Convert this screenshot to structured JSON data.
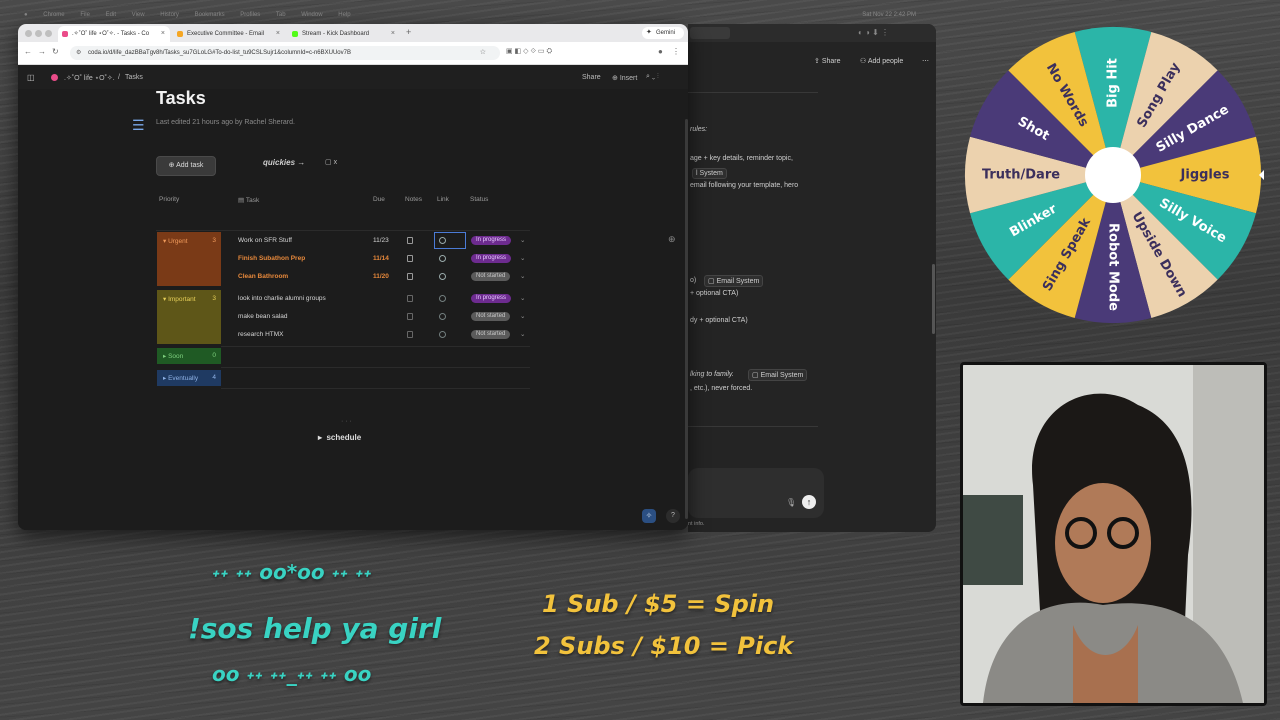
{
  "menubar": {
    "items": [
      "Chrome",
      "File",
      "Edit",
      "View",
      "History",
      "Bookmarks",
      "Profiles",
      "Tab",
      "Window",
      "Help"
    ],
    "clock": "Sat Nov 22  2:42 PM"
  },
  "browser": {
    "tabs": [
      {
        "label": ".✧˚O˚ life ⋆O˚✧. - Tasks - Co",
        "color": "#ea4c89"
      },
      {
        "label": "Executive Committee - Email",
        "color": "#f5a623"
      },
      {
        "label": "Stream - Kick Dashboard",
        "color": "#53fc18"
      }
    ],
    "url": "coda.io/d/life_dazBBaTgv8h/Tasks_su7GLoLG#To-do-list_tu9CSLSujr1&columnId=c-n6BXUUov7B",
    "gemini_label": "Gemini"
  },
  "coda": {
    "breadcrumb_doc": ".✧˚O˚ life ⋆O˚✧.",
    "breadcrumb_sep": "/",
    "breadcrumb_page": "Tasks",
    "share_label": "Share",
    "insert_label": "Insert",
    "title": "Tasks",
    "subtitle": "Last edited 21 hours ago by Rachel Sherard.",
    "add_task_label": "Add task",
    "quickies_label": "quickies →",
    "checkbox_x": "x",
    "columns": {
      "priority": "Priority",
      "task": "Task",
      "due": "Due",
      "notes": "Notes",
      "link": "Link",
      "status": "Status"
    },
    "groups": [
      {
        "name": "Urgent",
        "count": "3",
        "color": "#7a3a17",
        "text": "#f09a5b"
      },
      {
        "name": "Important",
        "count": "3",
        "color": "#5e5618",
        "text": "#e6cf58"
      },
      {
        "name": "Soon",
        "count": "0",
        "color": "#1f5a24",
        "text": "#7ed07e"
      },
      {
        "name": "Eventually",
        "count": "4",
        "color": "#1f3a62",
        "text": "#8fb2e6"
      }
    ],
    "rows": [
      {
        "task": "Work on SFR Stuff",
        "due": "11/23",
        "status": "In progress"
      },
      {
        "task": "Finish Subathon Prep",
        "due": "11/14",
        "status": "In progress"
      },
      {
        "task": "Clean Bathroom",
        "due": "11/20",
        "status": "Not started"
      },
      {
        "task": "look into charlie alumni groups",
        "due": "",
        "status": "In progress"
      },
      {
        "task": "make bean salad",
        "due": "",
        "status": "Not started"
      },
      {
        "task": "research HTMX",
        "due": "",
        "status": "Not started"
      }
    ],
    "schedule_label": "schedule",
    "dots": "· · ·",
    "help_label": "?"
  },
  "chat": {
    "share_label": "Share",
    "add_people_label": "Add people",
    "lines": [
      "rules:",
      "age + key details, reminder topic,",
      "email following your template, hero",
      "o)",
      "+ optional CTA)",
      "dy + optional CTA)",
      "lking to family.",
      ", etc.), never forced.",
      "nt info."
    ],
    "tag_label": "Email System",
    "tag_short": "l System"
  },
  "wheel": {
    "segments": [
      {
        "label": "Big Hit",
        "color": "#2bb5a8"
      },
      {
        "label": "Song Play",
        "color": "#ecd2ae"
      },
      {
        "label": "Silly Dance",
        "color": "#4a3a78"
      },
      {
        "label": "Jiggles",
        "color": "#f2c23c"
      },
      {
        "label": "Silly Voice",
        "color": "#2bb5a8"
      },
      {
        "label": "Upside Down",
        "color": "#ecd2ae"
      },
      {
        "label": "Robot Mode",
        "color": "#4a3a78"
      },
      {
        "label": "Sing Speak",
        "color": "#f2c23c"
      },
      {
        "label": "Blinker",
        "color": "#2bb5a8"
      },
      {
        "label": "Truth/Dare",
        "color": "#ecd2ae"
      },
      {
        "label": "Shot",
        "color": "#4a3a78"
      },
      {
        "label": "No Words",
        "color": "#f2c23c"
      }
    ]
  },
  "overlay": {
    "deco_top": "˖˖ ˖˖ oo*oo ˖˖ ˖˖",
    "handle": "!sos help ya girl",
    "deco_bottom": "oo ˖˖ ˖˖_˖˖ ˖˖ oo",
    "line1": "1 Sub / $5 = Spin",
    "line2": "2 Subs / $10 = Pick"
  }
}
